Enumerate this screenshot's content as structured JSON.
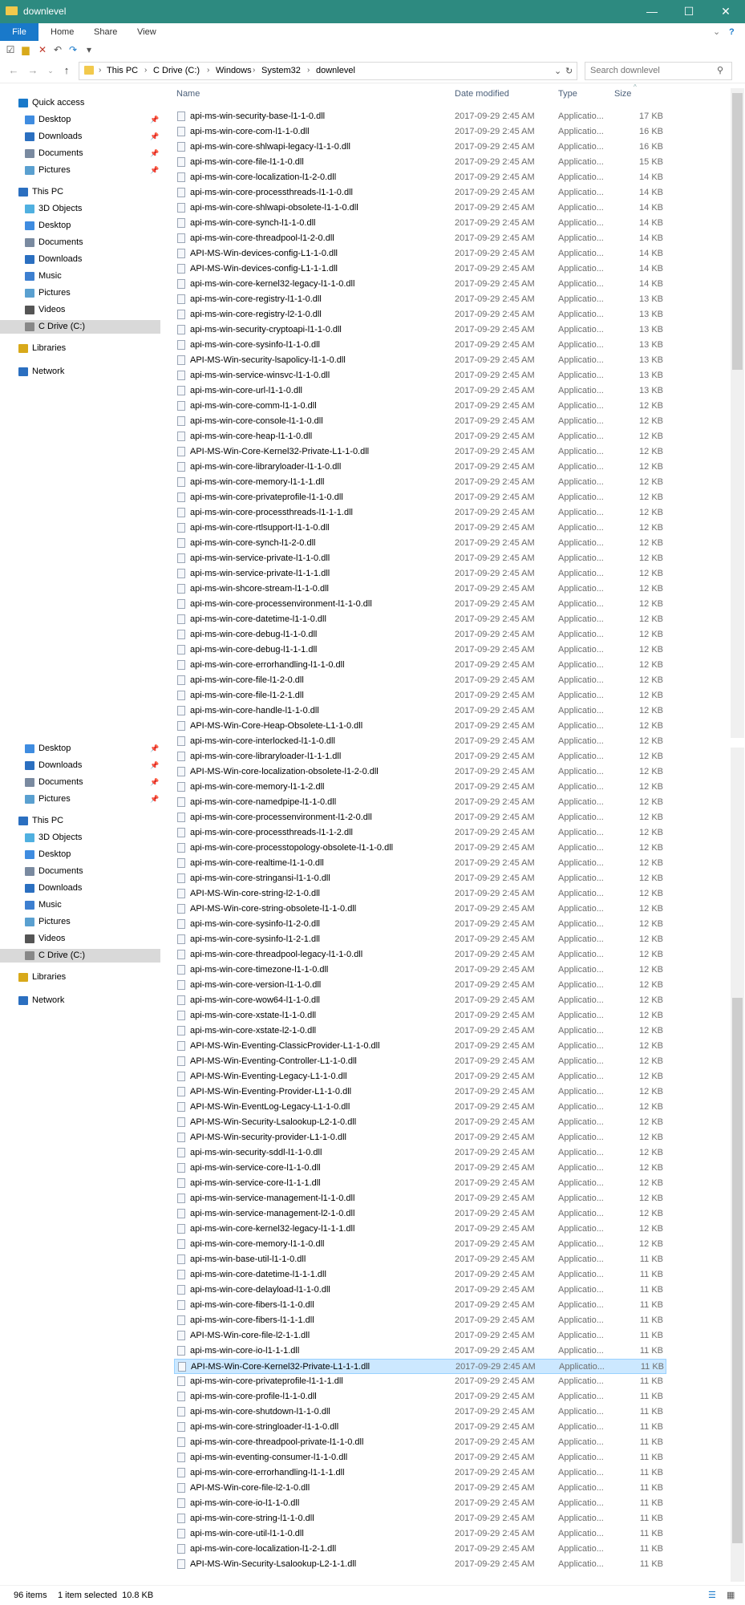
{
  "window": {
    "title": "downlevel",
    "minimize": "—",
    "maximize": "☐",
    "close": "✕"
  },
  "ribbon": {
    "tabs": [
      "File",
      "Home",
      "Share",
      "View"
    ]
  },
  "address": {
    "path": [
      "This PC",
      "C Drive (C:)",
      "Windows",
      "System32",
      "downlevel"
    ],
    "search_placeholder": "Search downlevel"
  },
  "nav": {
    "quick_access": "Quick access",
    "quick_items": [
      "Desktop",
      "Downloads",
      "Documents",
      "Pictures"
    ],
    "this_pc": "This PC",
    "pc_items": [
      "3D Objects",
      "Desktop",
      "Documents",
      "Downloads",
      "Music",
      "Pictures",
      "Videos",
      "C Drive (C:)"
    ],
    "libraries": "Libraries",
    "network": "Network"
  },
  "columns": {
    "name": "Name",
    "date": "Date modified",
    "type": "Type",
    "size": "Size"
  },
  "files": [
    [
      "api-ms-win-security-base-l1-1-0.dll",
      "17 KB"
    ],
    [
      "api-ms-win-core-com-l1-1-0.dll",
      "16 KB"
    ],
    [
      "api-ms-win-core-shlwapi-legacy-l1-1-0.dll",
      "16 KB"
    ],
    [
      "api-ms-win-core-file-l1-1-0.dll",
      "15 KB"
    ],
    [
      "api-ms-win-core-localization-l1-2-0.dll",
      "14 KB"
    ],
    [
      "api-ms-win-core-processthreads-l1-1-0.dll",
      "14 KB"
    ],
    [
      "api-ms-win-core-shlwapi-obsolete-l1-1-0.dll",
      "14 KB"
    ],
    [
      "api-ms-win-core-synch-l1-1-0.dll",
      "14 KB"
    ],
    [
      "api-ms-win-core-threadpool-l1-2-0.dll",
      "14 KB"
    ],
    [
      "API-MS-Win-devices-config-L1-1-0.dll",
      "14 KB"
    ],
    [
      "API-MS-Win-devices-config-L1-1-1.dll",
      "14 KB"
    ],
    [
      "api-ms-win-core-kernel32-legacy-l1-1-0.dll",
      "14 KB"
    ],
    [
      "api-ms-win-core-registry-l1-1-0.dll",
      "13 KB"
    ],
    [
      "api-ms-win-core-registry-l2-1-0.dll",
      "13 KB"
    ],
    [
      "api-ms-win-security-cryptoapi-l1-1-0.dll",
      "13 KB"
    ],
    [
      "api-ms-win-core-sysinfo-l1-1-0.dll",
      "13 KB"
    ],
    [
      "API-MS-Win-security-lsapolicy-l1-1-0.dll",
      "13 KB"
    ],
    [
      "api-ms-win-service-winsvc-l1-1-0.dll",
      "13 KB"
    ],
    [
      "api-ms-win-core-url-l1-1-0.dll",
      "13 KB"
    ],
    [
      "api-ms-win-core-comm-l1-1-0.dll",
      "12 KB"
    ],
    [
      "api-ms-win-core-console-l1-1-0.dll",
      "12 KB"
    ],
    [
      "api-ms-win-core-heap-l1-1-0.dll",
      "12 KB"
    ],
    [
      "API-MS-Win-Core-Kernel32-Private-L1-1-0.dll",
      "12 KB"
    ],
    [
      "api-ms-win-core-libraryloader-l1-1-0.dll",
      "12 KB"
    ],
    [
      "api-ms-win-core-memory-l1-1-1.dll",
      "12 KB"
    ],
    [
      "api-ms-win-core-privateprofile-l1-1-0.dll",
      "12 KB"
    ],
    [
      "api-ms-win-core-processthreads-l1-1-1.dll",
      "12 KB"
    ],
    [
      "api-ms-win-core-rtlsupport-l1-1-0.dll",
      "12 KB"
    ],
    [
      "api-ms-win-core-synch-l1-2-0.dll",
      "12 KB"
    ],
    [
      "api-ms-win-service-private-l1-1-0.dll",
      "12 KB"
    ],
    [
      "api-ms-win-service-private-l1-1-1.dll",
      "12 KB"
    ],
    [
      "api-ms-win-shcore-stream-l1-1-0.dll",
      "12 KB"
    ],
    [
      "api-ms-win-core-processenvironment-l1-1-0.dll",
      "12 KB"
    ],
    [
      "api-ms-win-core-datetime-l1-1-0.dll",
      "12 KB"
    ],
    [
      "api-ms-win-core-debug-l1-1-0.dll",
      "12 KB"
    ],
    [
      "api-ms-win-core-debug-l1-1-1.dll",
      "12 KB"
    ],
    [
      "api-ms-win-core-errorhandling-l1-1-0.dll",
      "12 KB"
    ],
    [
      "api-ms-win-core-file-l1-2-0.dll",
      "12 KB"
    ],
    [
      "api-ms-win-core-file-l1-2-1.dll",
      "12 KB"
    ],
    [
      "api-ms-win-core-handle-l1-1-0.dll",
      "12 KB"
    ],
    [
      "API-MS-Win-Core-Heap-Obsolete-L1-1-0.dll",
      "12 KB"
    ],
    [
      "api-ms-win-core-interlocked-l1-1-0.dll",
      "12 KB"
    ],
    [
      "api-ms-win-core-libraryloader-l1-1-1.dll",
      "12 KB"
    ],
    [
      "API-MS-Win-core-localization-obsolete-l1-2-0.dll",
      "12 KB"
    ],
    [
      "api-ms-win-core-memory-l1-1-2.dll",
      "12 KB"
    ],
    [
      "api-ms-win-core-namedpipe-l1-1-0.dll",
      "12 KB"
    ],
    [
      "api-ms-win-core-processenvironment-l1-2-0.dll",
      "12 KB"
    ],
    [
      "api-ms-win-core-processthreads-l1-1-2.dll",
      "12 KB"
    ],
    [
      "api-ms-win-core-processtopology-obsolete-l1-1-0.dll",
      "12 KB"
    ],
    [
      "api-ms-win-core-realtime-l1-1-0.dll",
      "12 KB"
    ],
    [
      "api-ms-win-core-stringansi-l1-1-0.dll",
      "12 KB"
    ],
    [
      "API-MS-Win-core-string-l2-1-0.dll",
      "12 KB"
    ],
    [
      "API-MS-Win-core-string-obsolete-l1-1-0.dll",
      "12 KB"
    ],
    [
      "api-ms-win-core-sysinfo-l1-2-0.dll",
      "12 KB"
    ],
    [
      "api-ms-win-core-sysinfo-l1-2-1.dll",
      "12 KB"
    ],
    [
      "api-ms-win-core-threadpool-legacy-l1-1-0.dll",
      "12 KB"
    ],
    [
      "api-ms-win-core-timezone-l1-1-0.dll",
      "12 KB"
    ],
    [
      "api-ms-win-core-version-l1-1-0.dll",
      "12 KB"
    ],
    [
      "api-ms-win-core-wow64-l1-1-0.dll",
      "12 KB"
    ],
    [
      "api-ms-win-core-xstate-l1-1-0.dll",
      "12 KB"
    ],
    [
      "api-ms-win-core-xstate-l2-1-0.dll",
      "12 KB"
    ],
    [
      "API-MS-Win-Eventing-ClassicProvider-L1-1-0.dll",
      "12 KB"
    ],
    [
      "API-MS-Win-Eventing-Controller-L1-1-0.dll",
      "12 KB"
    ],
    [
      "API-MS-Win-Eventing-Legacy-L1-1-0.dll",
      "12 KB"
    ],
    [
      "API-MS-Win-Eventing-Provider-L1-1-0.dll",
      "12 KB"
    ],
    [
      "API-MS-Win-EventLog-Legacy-L1-1-0.dll",
      "12 KB"
    ],
    [
      "API-MS-Win-Security-Lsalookup-L2-1-0.dll",
      "12 KB"
    ],
    [
      "API-MS-Win-security-provider-L1-1-0.dll",
      "12 KB"
    ],
    [
      "api-ms-win-security-sddl-l1-1-0.dll",
      "12 KB"
    ],
    [
      "api-ms-win-service-core-l1-1-0.dll",
      "12 KB"
    ],
    [
      "api-ms-win-service-core-l1-1-1.dll",
      "12 KB"
    ],
    [
      "api-ms-win-service-management-l1-1-0.dll",
      "12 KB"
    ],
    [
      "api-ms-win-service-management-l2-1-0.dll",
      "12 KB"
    ],
    [
      "api-ms-win-core-kernel32-legacy-l1-1-1.dll",
      "12 KB"
    ],
    [
      "api-ms-win-core-memory-l1-1-0.dll",
      "12 KB"
    ],
    [
      "api-ms-win-base-util-l1-1-0.dll",
      "11 KB"
    ],
    [
      "api-ms-win-core-datetime-l1-1-1.dll",
      "11 KB"
    ],
    [
      "api-ms-win-core-delayload-l1-1-0.dll",
      "11 KB"
    ],
    [
      "api-ms-win-core-fibers-l1-1-0.dll",
      "11 KB"
    ],
    [
      "api-ms-win-core-fibers-l1-1-1.dll",
      "11 KB"
    ],
    [
      "API-MS-Win-core-file-l2-1-1.dll",
      "11 KB"
    ],
    [
      "api-ms-win-core-io-l1-1-1.dll",
      "11 KB"
    ],
    [
      "API-MS-Win-Core-Kernel32-Private-L1-1-1.dll",
      "11 KB"
    ],
    [
      "api-ms-win-core-privateprofile-l1-1-1.dll",
      "11 KB"
    ],
    [
      "api-ms-win-core-profile-l1-1-0.dll",
      "11 KB"
    ],
    [
      "api-ms-win-core-shutdown-l1-1-0.dll",
      "11 KB"
    ],
    [
      "api-ms-win-core-stringloader-l1-1-0.dll",
      "11 KB"
    ],
    [
      "api-ms-win-core-threadpool-private-l1-1-0.dll",
      "11 KB"
    ],
    [
      "api-ms-win-eventing-consumer-l1-1-0.dll",
      "11 KB"
    ],
    [
      "api-ms-win-core-errorhandling-l1-1-1.dll",
      "11 KB"
    ],
    [
      "API-MS-Win-core-file-l2-1-0.dll",
      "11 KB"
    ],
    [
      "api-ms-win-core-io-l1-1-0.dll",
      "11 KB"
    ],
    [
      "api-ms-win-core-string-l1-1-0.dll",
      "11 KB"
    ],
    [
      "api-ms-win-core-util-l1-1-0.dll",
      "11 KB"
    ],
    [
      "api-ms-win-core-localization-l1-2-1.dll",
      "11 KB"
    ],
    [
      "API-MS-Win-Security-Lsalookup-L2-1-1.dll",
      "11 KB"
    ]
  ],
  "file_date": "2017-09-29 2:45 AM",
  "file_type": "Applicatio...",
  "selected_index": 82,
  "status": {
    "count": "96 items",
    "selection": "1 item selected  10.8 KB"
  }
}
